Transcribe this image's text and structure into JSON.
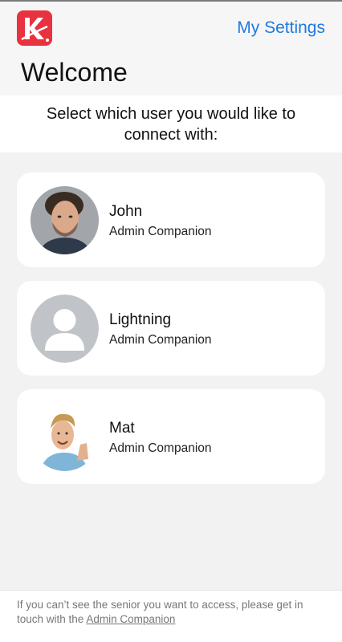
{
  "header": {
    "logo_icon": "app-logo-icon",
    "brand_color": "#e8323f",
    "settings_label": "My Settings",
    "link_color": "#1f7ae0",
    "title": "Welcome"
  },
  "prompt": {
    "text": "Select which user you would like to connect with:"
  },
  "users": [
    {
      "name": "John",
      "role": "Admin Companion",
      "avatar": "photo-avatar"
    },
    {
      "name": "Lightning",
      "role": "Admin Companion",
      "avatar": "default-user-icon"
    },
    {
      "name": "Mat",
      "role": "Admin Companion",
      "avatar": "photo-avatar"
    }
  ],
  "footer": {
    "text": "If you can’t see the senior you want to access, please get in touch with the",
    "link_label": "Admin Companion"
  }
}
